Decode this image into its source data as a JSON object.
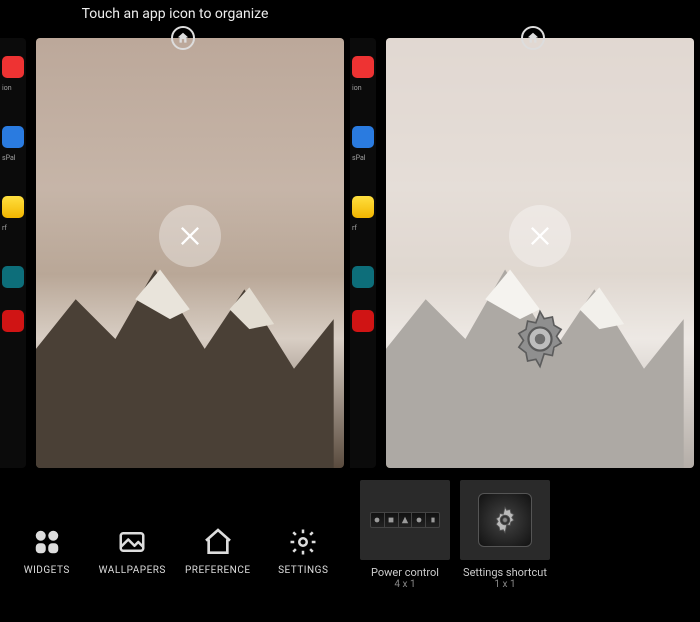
{
  "instruction": "Touch an app icon to organize",
  "toolbar": [
    {
      "name": "widgets",
      "label": "WIDGETS"
    },
    {
      "name": "wallpapers",
      "label": "WALLPAPERS"
    },
    {
      "name": "preference",
      "label": "PREFERENCE"
    },
    {
      "name": "settings",
      "label": "SETTINGS"
    }
  ],
  "widgets": [
    {
      "name": "Power control",
      "size": "4 x 1"
    },
    {
      "name": "Settings shortcut",
      "size": "1 x 1"
    }
  ],
  "sliver_labels": [
    "ion",
    "sPal",
    "rf",
    ""
  ]
}
